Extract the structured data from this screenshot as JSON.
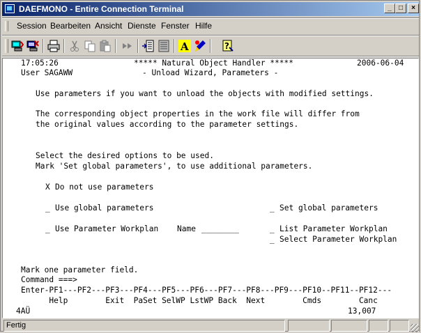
{
  "window": {
    "title": "DAEFMONO - Entire Connection Terminal",
    "controls": {
      "minimize": "_",
      "maximize": "□",
      "close": "×"
    }
  },
  "menubar": {
    "items": [
      "Session",
      "Bearbeiten",
      "Ansicht",
      "Dienste",
      "Fenster",
      "Hilfe"
    ]
  },
  "toolbar": {
    "icons": [
      "connect-icon",
      "disconnect-icon",
      "print-icon",
      "cut-icon",
      "copy-icon",
      "paste-icon",
      "transfer-icon",
      "receive-icon",
      "macro-icon",
      "font-icon",
      "color-icon",
      "help-icon"
    ]
  },
  "terminal": {
    "time": "17:05:26",
    "header": "***** Natural Object Handler *****",
    "date": "2006-06-04",
    "user": "User SAGAWW",
    "subtitle": "- Unload Wizard, Parameters -",
    "desc1": "Use parameters if you want to unload the objects with modified settings.",
    "desc2": "The corresponding object properties in the work file will differ from",
    "desc3": "the original values according to the parameter settings.",
    "instr1": "Select the desired options to be used.",
    "instr2": "Mark 'Set global parameters', to use additional parameters.",
    "options": {
      "no_params_mark": "X",
      "no_params": "Do not use parameters",
      "global_mark": "_",
      "global": "Use global parameters",
      "set_global_mark": "_",
      "set_global": "Set global parameters",
      "workplan_mark": "_",
      "workplan": "Use Parameter Workplan",
      "name_label": "Name",
      "name_value": "________",
      "list_mark": "_",
      "list_workplan": "List Parameter Workplan",
      "select_mark": "_",
      "select_workplan": "Select Parameter Workplan"
    },
    "message": "Mark one parameter field.",
    "command_label": "Command ===>",
    "pf_header": "Enter-PF1---PF2---PF3---PF4---PF5---PF6---PF7---PF8---PF9---PF10--PF11--PF12---",
    "pf_labels": "      Help        Exit  PaSet SelWP LstWP Back  Next        Cmds        Canc",
    "bottom_left": "4AÜ",
    "bottom_right": "13,007"
  },
  "statusbar": {
    "text": "Fertig"
  }
}
